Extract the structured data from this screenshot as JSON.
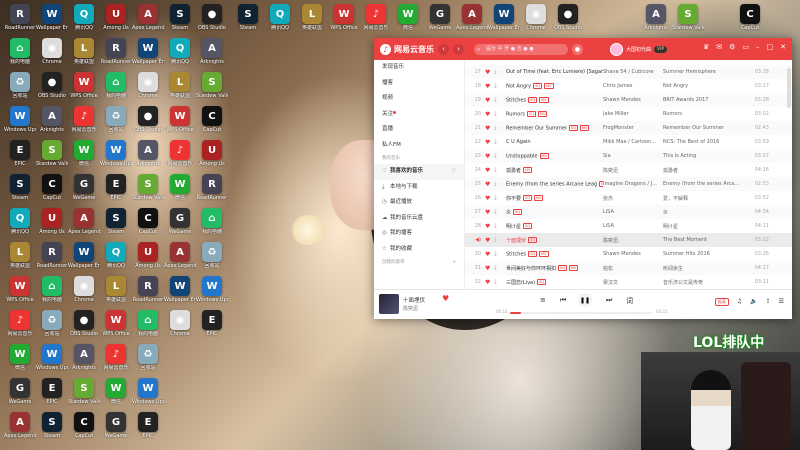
{
  "desktop": {
    "icons": [
      {
        "label": "RoadRunner",
        "color": "#445",
        "glyph": "R"
      },
      {
        "label": "我的电脑",
        "color": "#2b6",
        "glyph": "⌂"
      },
      {
        "label": "回收站",
        "color": "#8ab",
        "glyph": "♻"
      },
      {
        "label": "Windows Update",
        "color": "#27c",
        "glyph": "W"
      },
      {
        "label": "EPIC",
        "color": "#222",
        "glyph": "E"
      },
      {
        "label": "Steam",
        "color": "#123",
        "glyph": "S"
      },
      {
        "label": "腾讯QQ",
        "color": "#1ab",
        "glyph": "Q"
      },
      {
        "label": "英雄联盟",
        "color": "#a83",
        "glyph": "L"
      },
      {
        "label": "WPS Office",
        "color": "#c33",
        "glyph": "W"
      },
      {
        "label": "网易云音乐",
        "color": "#e33",
        "glyph": "♪"
      },
      {
        "label": "微信",
        "color": "#2a3",
        "glyph": "W"
      },
      {
        "label": "WeGame",
        "color": "#333",
        "glyph": "G"
      },
      {
        "label": "Apex Legends",
        "color": "#933",
        "glyph": "A"
      },
      {
        "label": "Wallpaper Engine",
        "color": "#147",
        "glyph": "W"
      },
      {
        "label": "Chrome",
        "color": "#ddd",
        "glyph": "◉"
      },
      {
        "label": "OBS Studio",
        "color": "#222",
        "glyph": "●"
      },
      {
        "label": "Arknights",
        "color": "#556",
        "glyph": "A"
      },
      {
        "label": "Stardew Valley",
        "color": "#6a3",
        "glyph": "S"
      },
      {
        "label": "CapCut",
        "color": "#111",
        "glyph": "C"
      },
      {
        "label": "Among Us",
        "color": "#a22",
        "glyph": "U"
      }
    ]
  },
  "app": {
    "logo_text": "网易云音乐",
    "search_placeholder": "提示 中 罗 ● 吉 ● ●",
    "username": "大国初代曲",
    "vip_label": "VIP",
    "nav": {
      "discover": "发现音乐",
      "podcast": "播客",
      "video": "视频",
      "follow": "关注",
      "live": "直播",
      "fm": "私人FM",
      "my_music_header": "我的音乐",
      "liked": "我喜欢的音乐",
      "local": "本地与下载",
      "recent": "最近播放",
      "cloud": "我的音乐云盘",
      "my_podcast": "我的播客",
      "favorites": "我的收藏",
      "created_header": "创建的歌单"
    },
    "songs": [
      {
        "no": "17",
        "title": "Out of Time (feat. Eric Lumiere) [Sagan R...",
        "tags": [],
        "artist": "Shane 54 / Cubicore",
        "album": "Summer Hemisphere",
        "time": "03:28"
      },
      {
        "no": "18",
        "title": "Not Angry",
        "tags": [
          "SQ",
          "MV"
        ],
        "artist": "Chris James",
        "album": "Not Angry",
        "time": "03:17"
      },
      {
        "no": "19",
        "title": "Stitches",
        "tags": [
          "SQ",
          "MV"
        ],
        "artist": "Shawn Mendes",
        "album": "BRIT Awards 2017",
        "time": "03:28"
      },
      {
        "no": "20",
        "title": "Rumors",
        "tags": [
          "SQ",
          "MV"
        ],
        "artist": "Jake Miller",
        "album": "Rumors",
        "time": "03:02"
      },
      {
        "no": "21",
        "title": "Remember Our Summer",
        "tags": [
          "SQ",
          "MV"
        ],
        "artist": "FrogMonster",
        "album": "Remember Our Summer",
        "time": "02:43"
      },
      {
        "no": "22",
        "title": "C U Again",
        "tags": [],
        "artist": "Mikk Mae / Cartoon...",
        "album": "NCS: The Best of 2016",
        "time": "03:59"
      },
      {
        "no": "23",
        "title": "Unstoppable",
        "tags": [
          "MV"
        ],
        "artist": "Sia",
        "album": "This Is Acting",
        "time": "03:37"
      },
      {
        "no": "24",
        "title": "孤勇者",
        "tags": [
          "MV"
        ],
        "artist": "陈奕迅",
        "album": "孤勇者",
        "time": "04:16"
      },
      {
        "no": "25",
        "title": "Enemy (from the series Arcane Leag",
        "tags": [
          "MV"
        ],
        "artist": "Imagine Dragons / J...",
        "album": "Enemy (from the series Arca...",
        "time": "02:53"
      },
      {
        "no": "26",
        "title": "你不要",
        "tags": [
          "SQ",
          "MV"
        ],
        "artist": "张杰",
        "album": "爱，不解释",
        "time": "03:52"
      },
      {
        "no": "27",
        "title": "炎",
        "tags": [
          "SQ"
        ],
        "artist": "LiSA",
        "album": "炎",
        "time": "04:34"
      },
      {
        "no": "28",
        "title": "明け星",
        "tags": [
          "SQ"
        ],
        "artist": "LiSA",
        "album": "明け星",
        "time": "04:11"
      },
      {
        "no": "29",
        "title": "十面埋伏",
        "tags": [
          "SQ"
        ],
        "artist": "陈奕迅",
        "album": "The Best Moment",
        "time": "03:22"
      },
      {
        "no": "30",
        "title": "Stitches",
        "tags": [
          "SQ",
          "MV"
        ],
        "artist": "Shawn Mendes",
        "album": "Summer Hits 2016",
        "time": "03:26"
      },
      {
        "no": "31",
        "title": "世间美好与你环环相扣",
        "tags": [
          "SQ",
          "MV"
        ],
        "artist": "柏松",
        "album": "听闻余生",
        "time": "04:17"
      },
      {
        "no": "32",
        "title": "三国恋(Live)",
        "tags": [
          "SQ"
        ],
        "artist": "梁汉文",
        "album": "音乐济公文是传奇",
        "time": "03:11"
      }
    ],
    "playing_index": 12,
    "player": {
      "title": "十面埋伏",
      "artist": "陈奕迅",
      "current_time": "00:16",
      "total_time": "03:22",
      "progress": 0.08,
      "quality": "极高"
    }
  },
  "overlay": {
    "label": "LOL排队中"
  }
}
